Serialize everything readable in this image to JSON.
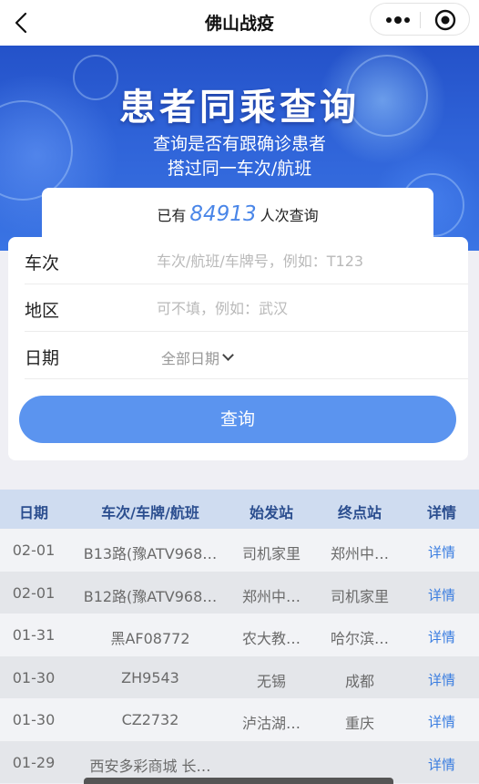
{
  "nav": {
    "title": "佛山战疫"
  },
  "banner": {
    "title": "患者同乘查询",
    "subtitle_line1": "查询是否有跟确诊患者",
    "subtitle_line2": "搭过同一车次/航班"
  },
  "counter": {
    "prefix": "已有",
    "count": "84913",
    "suffix": "人次查询"
  },
  "form": {
    "trip": {
      "label": "车次",
      "placeholder": "车次/航班/车牌号，例如：T123"
    },
    "region": {
      "label": "地区",
      "placeholder": "可不填，例如：武汉"
    },
    "date": {
      "label": "日期",
      "value": "全部日期"
    },
    "submit_label": "查询"
  },
  "table": {
    "headers": [
      "日期",
      "车次/车牌/航班",
      "始发站",
      "终点站",
      "详情"
    ],
    "rows": [
      {
        "date": "02-01",
        "trip": "B13路(豫ATV968…",
        "from": "司机家里",
        "to": "郑州中…",
        "detail": "详情"
      },
      {
        "date": "02-01",
        "trip": "B12路(豫ATV968…",
        "from": "郑州中…",
        "to": "司机家里",
        "detail": "详情"
      },
      {
        "date": "01-31",
        "trip": "黑AF08772",
        "from": "农大教…",
        "to": "哈尔滨…",
        "detail": "详情"
      },
      {
        "date": "01-30",
        "trip": "ZH9543",
        "from": "无锡",
        "to": "成都",
        "detail": "详情"
      },
      {
        "date": "01-30",
        "trip": "CZ2732",
        "from": "泸沽湖…",
        "to": "重庆",
        "detail": "详情"
      },
      {
        "date": "01-29",
        "trip": "西安多彩商城 长…",
        "from": "",
        "to": "",
        "detail": "详情"
      }
    ]
  },
  "colors": {
    "accent": "#5b94ef",
    "banner": "#2f63d8",
    "link": "#3a7de0"
  },
  "icons": {
    "back": "chevron-left-icon",
    "more": "more-dots-icon",
    "close": "target-close-icon"
  }
}
